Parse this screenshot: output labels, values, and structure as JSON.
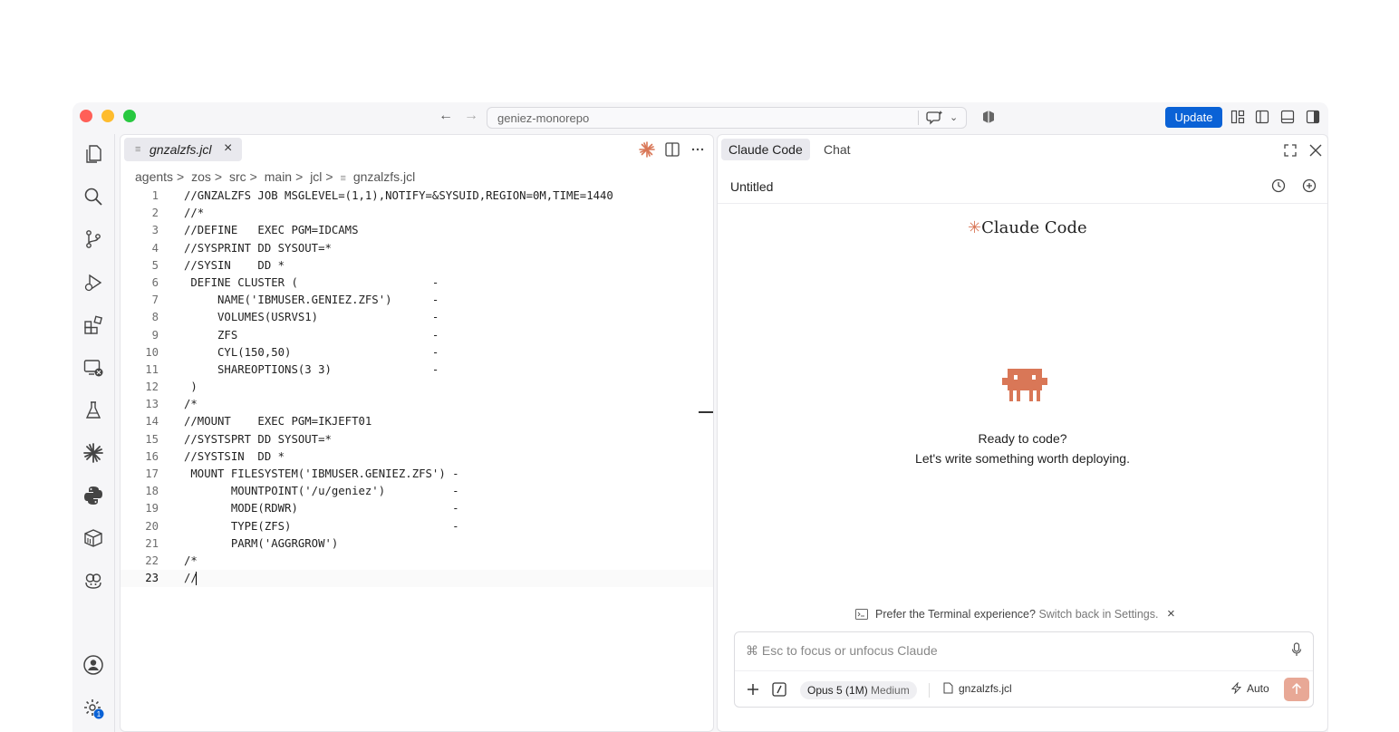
{
  "titlebar": {
    "command_center": "geniez-monorepo",
    "update_label": "Update"
  },
  "editor": {
    "tab": {
      "filename": "gnzalzfs.jcl"
    },
    "breadcrumb": [
      "agents",
      "zos",
      "src",
      "main",
      "jcl",
      "gnzalzfs.jcl"
    ],
    "lines": [
      "//GNZALZFS JOB MSGLEVEL=(1,1),NOTIFY=&SYSUID,REGION=0M,TIME=1440",
      "//*",
      "//DEFINE   EXEC PGM=IDCAMS",
      "//SYSPRINT DD SYSOUT=*",
      "//SYSIN    DD *",
      " DEFINE CLUSTER (                    -",
      "     NAME('IBMUSER.GENIEZ.ZFS')      -",
      "     VOLUMES(USRVS1)                 -",
      "     ZFS                             -",
      "     CYL(150,50)                     -",
      "     SHAREOPTIONS(3 3)               -",
      " )",
      "/*",
      "//MOUNT    EXEC PGM=IKJEFT01",
      "//SYSTSPRT DD SYSOUT=*",
      "//SYSTSIN  DD *",
      " MOUNT FILESYSTEM('IBMUSER.GENIEZ.ZFS') -",
      "       MOUNTPOINT('/u/geniez')          -",
      "       MODE(RDWR)                       -",
      "       TYPE(ZFS)                        -",
      "       PARM('AGGRGROW')",
      "/*",
      "//"
    ],
    "active_line": 23
  },
  "claude": {
    "tabs": [
      "Claude Code",
      "Chat"
    ],
    "session_title": "Untitled",
    "brand_star": "✳",
    "brand_name": "Claude Code",
    "ready_line1": "Ready to code?",
    "ready_line2": "Let's write something worth deploying.",
    "prefer_text": "Prefer the Terminal experience?",
    "prefer_link": "Switch back in Settings.",
    "input_placeholder": "⌘ Esc to focus or unfocus Claude",
    "model": "Opus 5 (1M)",
    "effort": "Medium",
    "file_ref": "gnzalzfs.jcl",
    "mode": "Auto"
  },
  "activity": {
    "settings_badge": "1"
  },
  "colors": {
    "accent": "#0a62d6",
    "claude_orange": "#d97757",
    "send_button": "#e8a896"
  }
}
